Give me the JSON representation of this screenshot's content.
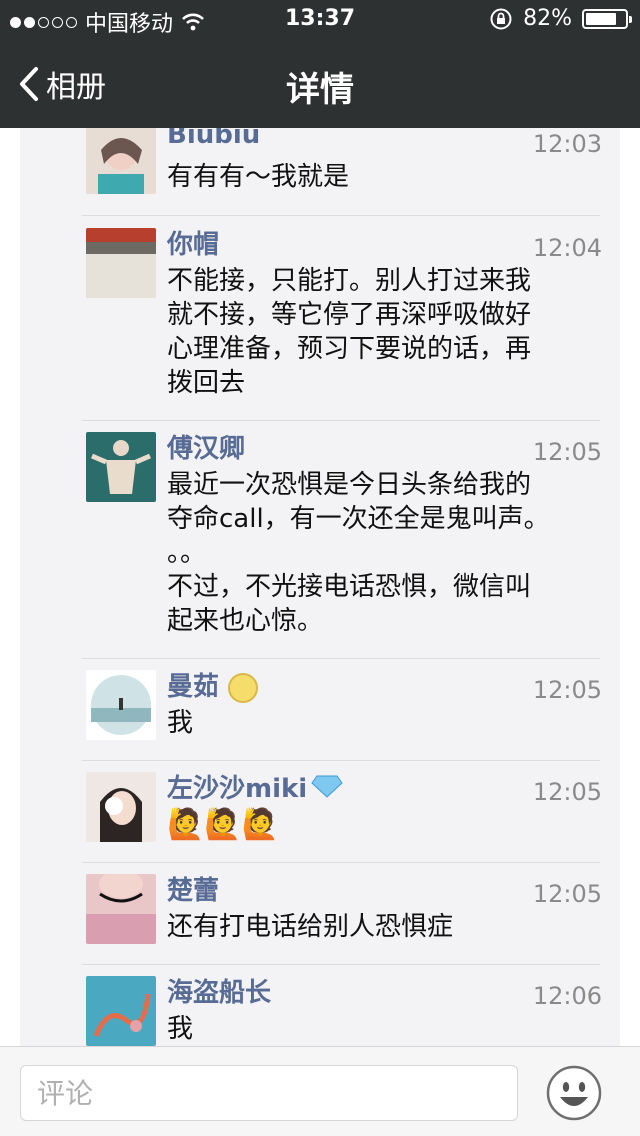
{
  "status_bar": {
    "carrier": "中国移动",
    "time": "13:37",
    "battery": "82%",
    "battery_level": 0.82
  },
  "nav": {
    "back_label": "相册",
    "title": "详情"
  },
  "comments": [
    {
      "name": "Biubiu",
      "time": "12:03",
      "lines": [
        "有有有～我就是"
      ]
    },
    {
      "name": "你帽",
      "time": "12:04",
      "lines": [
        "不能接，只能打。别人打过来我",
        "就不接，等它停了再深呼吸做好",
        "心理准备，预习下要说的话，再",
        "拨回去"
      ]
    },
    {
      "name": "傅汉卿",
      "time": "12:05",
      "lines": [
        "最近一次恐惧是今日头条给我的",
        "夺命call，有一次还全是鬼叫声。",
        "。。",
        "不过，不光接电话恐惧，微信叫",
        "起来也心惊。"
      ]
    },
    {
      "name": "曼茹",
      "time": "12:05",
      "lines": [
        "我"
      ]
    },
    {
      "name": "左沙沙miki",
      "time": "12:05",
      "lines": [
        "🙋🙋🙋"
      ]
    },
    {
      "name": "楚蕾",
      "time": "12:05",
      "lines": [
        "还有打电话给别人恐惧症"
      ]
    },
    {
      "name": "海盗船长",
      "time": "12:06",
      "lines": [
        "我"
      ]
    }
  ],
  "composer": {
    "placeholder": "评论"
  }
}
